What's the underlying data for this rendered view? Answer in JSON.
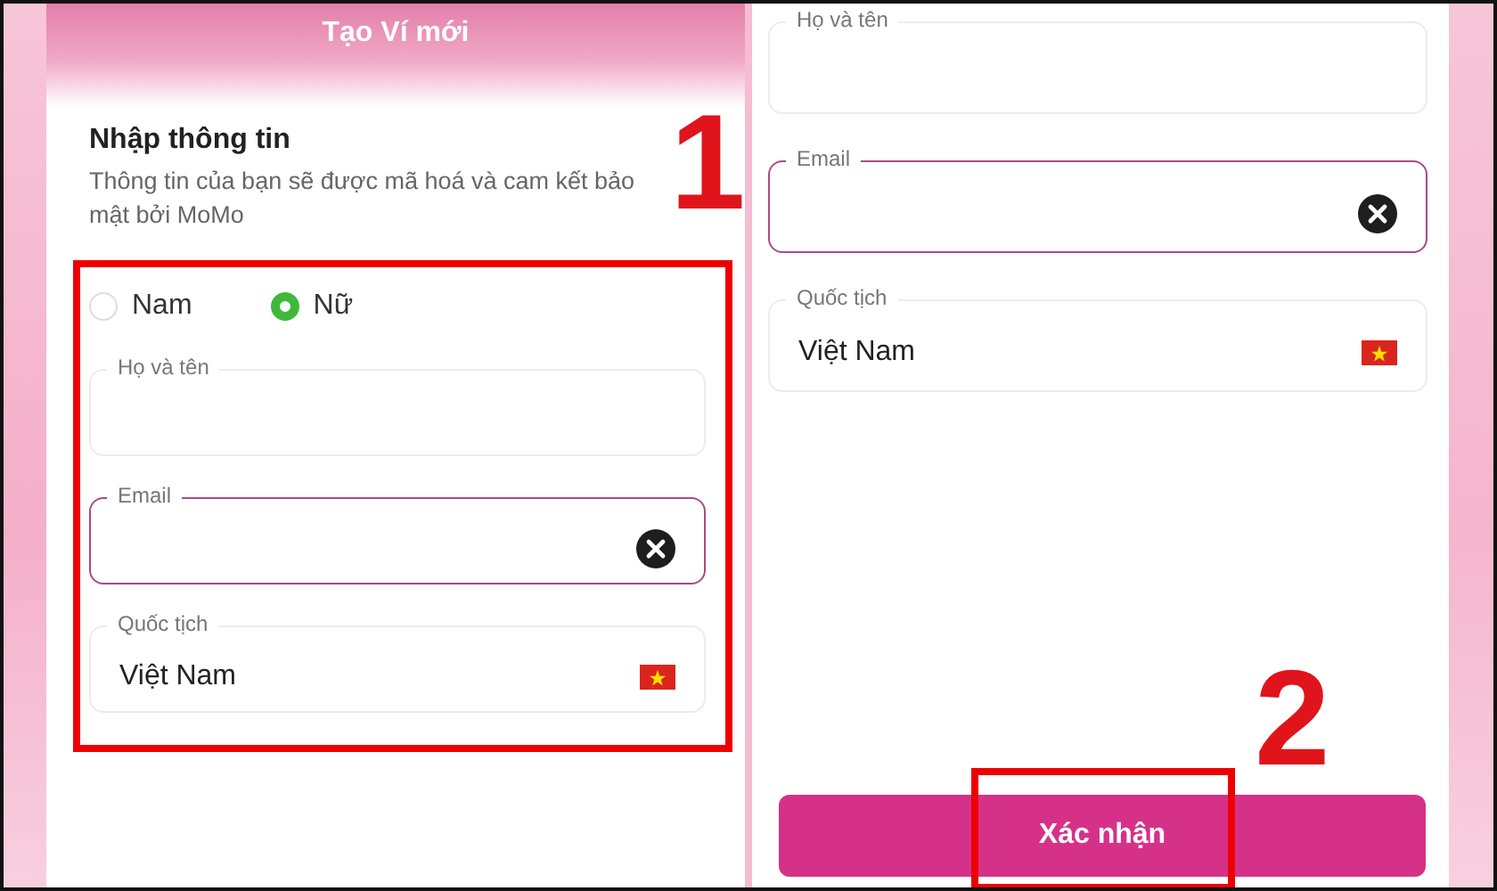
{
  "left_screen": {
    "title": "Tạo Ví mới",
    "heading": "Nhập thông tin",
    "description": "Thông tin của bạn sẽ được mã hoá và cam kết bảo mật bởi MoMo",
    "gender_options": [
      {
        "label": "Nam",
        "selected": false
      },
      {
        "label": "Nữ",
        "selected": true
      }
    ],
    "fields": [
      {
        "label": "Họ và tên",
        "kind": "text",
        "focused": false
      },
      {
        "label": "Email",
        "kind": "clearable",
        "focused": true
      },
      {
        "label": "Quốc tịch",
        "value": "Việt Nam",
        "kind": "country",
        "focused": false
      }
    ]
  },
  "right_screen": {
    "fields": [
      {
        "label": "Họ và tên",
        "kind": "text",
        "focused": false
      },
      {
        "label": "Email",
        "kind": "clearable",
        "focused": true
      },
      {
        "label": "Quốc tịch",
        "value": "Việt Nam",
        "kind": "country",
        "focused": false
      }
    ],
    "confirm_button": "Xác nhận"
  },
  "annotations": [
    {
      "label": "1"
    },
    {
      "label": "2"
    }
  ]
}
